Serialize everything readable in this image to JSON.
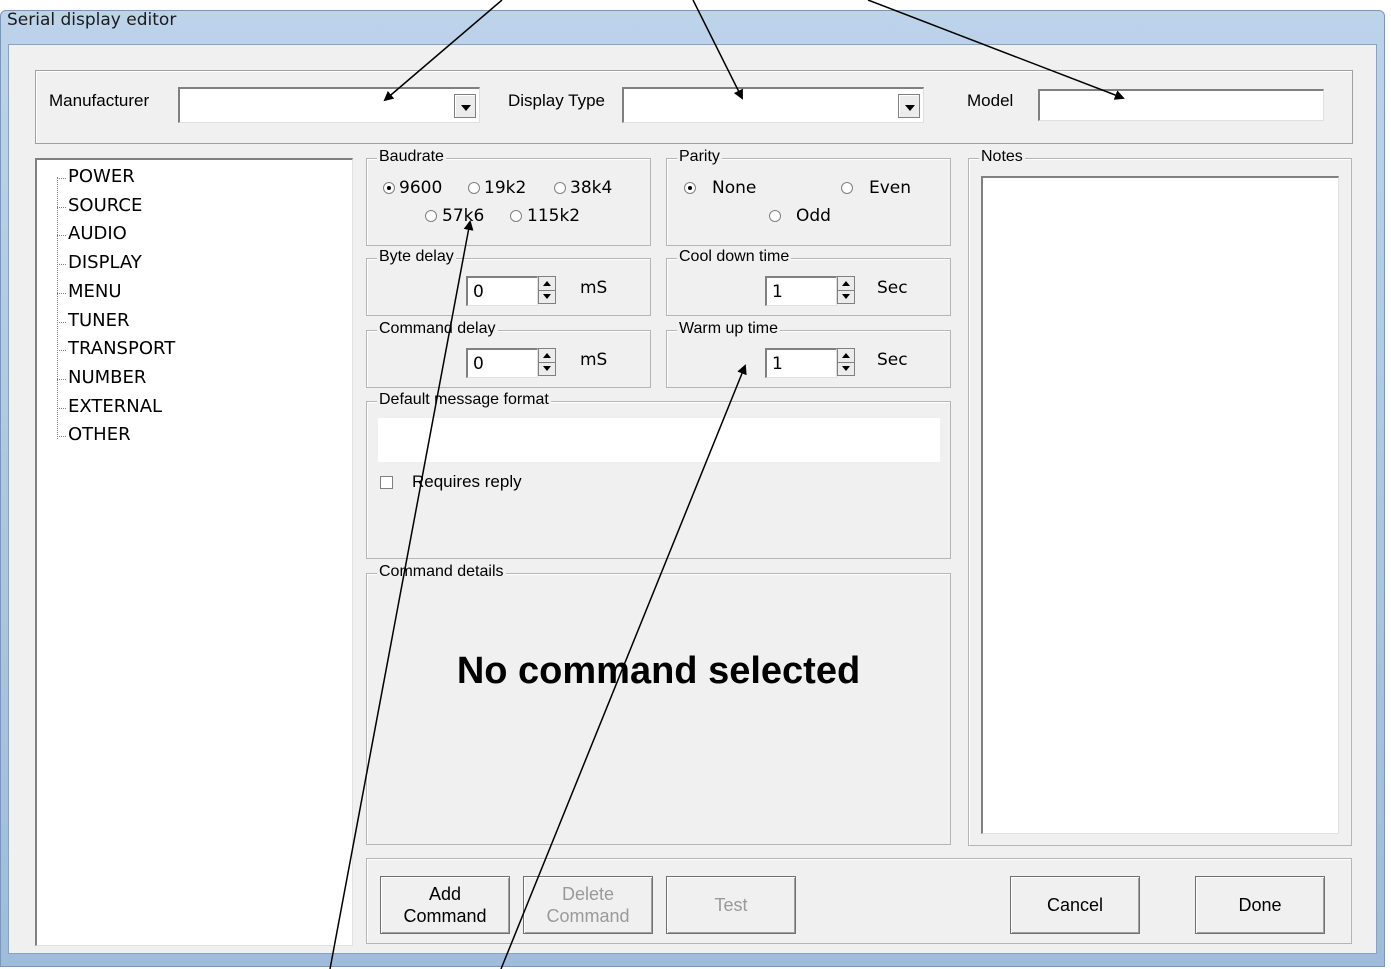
{
  "window": {
    "title": "Serial display editor"
  },
  "header": {
    "manufacturer_label": "Manufacturer",
    "manufacturer_value": "",
    "display_type_label": "Display Type",
    "display_type_value": "",
    "model_label": "Model",
    "model_value": ""
  },
  "tree": {
    "items": [
      "POWER",
      "SOURCE",
      "AUDIO",
      "DISPLAY",
      "MENU",
      "TUNER",
      "TRANSPORT",
      "NUMBER",
      "EXTERNAL",
      "OTHER"
    ]
  },
  "baudrate": {
    "label": "Baudrate",
    "options": [
      "9600",
      "19k2",
      "38k4",
      "57k6",
      "115k2"
    ],
    "selected": "9600"
  },
  "parity": {
    "label": "Parity",
    "options": [
      "None",
      "Even",
      "Odd"
    ],
    "selected": "None"
  },
  "byte_delay": {
    "label": "Byte delay",
    "value": "0",
    "unit": "mS"
  },
  "cool_down": {
    "label": "Cool down time",
    "value": "1",
    "unit": "Sec"
  },
  "command_delay": {
    "label": "Command delay",
    "value": "0",
    "unit": "mS"
  },
  "warm_up": {
    "label": "Warm up time",
    "value": "1",
    "unit": "Sec"
  },
  "default_format": {
    "label": "Default message format",
    "value": "",
    "requires_reply_label": "Requires reply",
    "requires_reply": false
  },
  "command_details": {
    "label": "Command details",
    "message": "No command selected"
  },
  "notes": {
    "label": "Notes",
    "value": ""
  },
  "buttons": {
    "add_line1": "Add",
    "add_line2": "Command",
    "delete_line1": "Delete",
    "delete_line2": "Command",
    "test": "Test",
    "cancel": "Cancel",
    "done": "Done"
  }
}
